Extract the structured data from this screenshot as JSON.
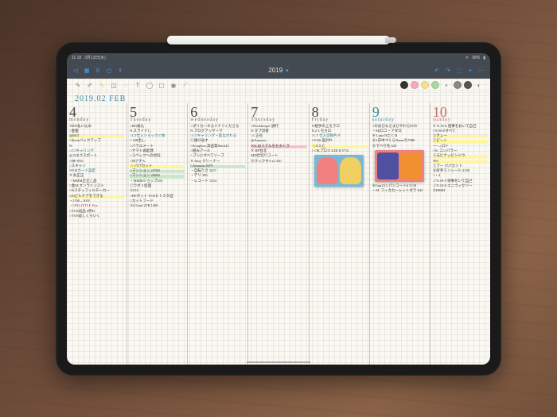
{
  "status": {
    "time": "11:18",
    "date": "3月13日(水)",
    "battery": "98%"
  },
  "app": {
    "back": "◁",
    "title": "2019",
    "dropdown": "▾"
  },
  "toolbar_colors": {
    "black": "#333333",
    "pink": "#f8a8c0",
    "yellow": "#f8e088",
    "green": "#a8d8a0",
    "gray": "#888888",
    "darkgray": "#555555"
  },
  "planner": {
    "month_header": "2019.02 FEB",
    "days": [
      {
        "num": "4",
        "name": "monday",
        "class": "",
        "entries": [
          {
            "t": "✕RN払い込み",
            "c": ""
          },
          {
            "t": "○金髪",
            "c": ""
          },
          {
            "t": "◎M15",
            "c": "hl-yellow"
          },
          {
            "t": "○Slackバックアップ",
            "c": ""
          },
          {
            "t": "N.",
            "c": ""
          },
          {
            "t": "○CTキャリング",
            "c": "blue-ink"
          },
          {
            "t": "◎ Nエクスポート",
            "c": ""
          },
          {
            "t": "○HP SNS",
            "c": ""
          },
          {
            "t": "○スキャン",
            "c": ""
          },
          {
            "t": "NNMカード設定",
            "c": "blue-ink"
          },
          {
            "t": "✕ お正正",
            "c": ""
          },
          {
            "t": "・MMM正正こ品",
            "c": ""
          },
          {
            "t": "○金M オンラインスト",
            "c": ""
          },
          {
            "t": "○Nスタッフィルターカー",
            "c": ""
          },
          {
            "t": "○Elビルケアをできる",
            "c": "hl-yellow"
          },
          {
            "t": "・11M→ASV",
            "c": ""
          },
          {
            "t": "・OH LITTLE Fire",
            "c": "red-ink"
          },
          {
            "t": "○YOS返品 4件D",
            "c": ""
          },
          {
            "t": "○YOS返しくらいく",
            "c": ""
          }
        ]
      },
      {
        "num": "5",
        "name": "Tuesday",
        "class": "",
        "entries": [
          {
            "t": "○RN振込",
            "c": ""
          },
          {
            "t": "N.スライドし",
            "c": ""
          },
          {
            "t": "○CT仕入ショック27本",
            "c": "blue-ink"
          },
          {
            "t": "○ GB出し",
            "c": ""
          },
          {
            "t": "○バラエメート",
            "c": ""
          },
          {
            "t": "○ヤマト再配達",
            "c": ""
          },
          {
            "t": "○スペックへの合同",
            "c": ""
          },
          {
            "t": "○MナチA",
            "c": ""
          },
          {
            "t": "⭐パパカット",
            "c": "hl-yellow"
          },
          {
            "t": "○マンション    23700",
            "c": "hl-green"
          },
          {
            "t": "○マンション    28500",
            "c": "hl-green"
          },
          {
            "t": "・MMMショップ255",
            "c": ""
          },
          {
            "t": "◎ラボ 5 処理",
            "c": ""
          },
          {
            "t": "  ①210",
            "c": ""
          },
          {
            "t": "○DFボット YOSヒトスタ証",
            "c": ""
          },
          {
            "t": "○カットフード",
            "c": ""
          },
          {
            "t": "①iCloud 2TB    1400",
            "c": ""
          }
        ]
      },
      {
        "num": "6",
        "name": "wednesday",
        "class": "",
        "entries": [
          {
            "t": "○ポリカーネカミナリくださる",
            "c": ""
          },
          {
            "t": "N.ブログアッサーマ",
            "c": ""
          },
          {
            "t": "○CTキャリング・館なかれる",
            "c": "blue-ink"
          },
          {
            "t": "◎請け返す",
            "c": ""
          },
          {
            "t": "○Scrapbox 高品質Slackに",
            "c": ""
          },
          {
            "t": "○組みアール",
            "c": ""
          },
          {
            "t": "○プシにすべてソープ",
            "c": ""
          },
          {
            "t": "✕ Amy クリーナー",
            "c": ""
          },
          {
            "t": "○Amazon     2979",
            "c": "hl-green"
          },
          {
            "t": "  ・自転りさ 3437",
            "c": ""
          },
          {
            "t": "  ・デリ     300",
            "c": ""
          },
          {
            "t": "  ・レコート 1354",
            "c": ""
          }
        ]
      },
      {
        "num": "7",
        "name": "Thursday",
        "class": "",
        "entries": [
          {
            "t": "○Duckkeeper 調行",
            "c": ""
          },
          {
            "t": "N.タブ切替",
            "c": ""
          },
          {
            "t": "○C正長",
            "c": "blue-ink"
          },
          {
            "t": "◎Amazon",
            "c": ""
          },
          {
            "t": "✕N.おリアルをセネトラ",
            "c": "hl-pink"
          },
          {
            "t": "✕ HP台北",
            "c": ""
          },
          {
            "t": "MD仕切りコート",
            "c": ""
          },
          {
            "t": "⑥クックキ3 x2  320",
            "c": ""
          }
        ]
      },
      {
        "num": "8",
        "name": "Friday",
        "class": "",
        "entries": [
          {
            "t": "✕相手の上モラロ",
            "c": ""
          },
          {
            "t": "N.2 3 モカロ",
            "c": ""
          },
          {
            "t": "○CT 仕入切替片④",
            "c": "blue-ink"
          },
          {
            "t": "○YOS 設計れ",
            "c": ""
          },
          {
            "t": "⭐Eミと",
            "c": "hl-yellow"
          },
          {
            "t": "○ OKプロジェIB D  5731",
            "c": ""
          }
        ],
        "photo": 1
      },
      {
        "num": "9",
        "name": "saturday",
        "class": "saturday",
        "entries": [
          {
            "t": "○のおひなさまひやわらわわ",
            "c": ""
          },
          {
            "t": "・MIロコ・アダロ",
            "c": ""
          },
          {
            "t": "⑥ Luna Nた C B",
            "c": ""
          },
          {
            "t": "⑥1日中づくらNameち7980",
            "c": ""
          },
          {
            "t": "⑥でべり先  420",
            "c": ""
          }
        ],
        "photo": 2,
        "after": [
          {
            "t": "⑥Gap10.5 パシコート6  5138",
            "c": ""
          },
          {
            "t": "・M. フィカカーレットガラ  943",
            "c": ""
          }
        ]
      },
      {
        "num": "10",
        "name": "sunday",
        "class": "sunday",
        "entries": [
          {
            "t": "✕ N.18-S 侵事をおいて自己",
            "c": ""
          },
          {
            "t": "○YOS③すべて",
            "c": ""
          },
          {
            "t": "①きょー",
            "c": "hl-yellow"
          },
          {
            "t": "①ビーン",
            "c": "hl-yellow"
          },
          {
            "t": "  ──→ロト",
            "c": ""
          },
          {
            "t": "○N. コンパラー",
            "c": ""
          },
          {
            "t": "①モビナッピンドウ",
            "c": "hl-yellow"
          },
          {
            "t": "  595",
            "c": "hl-yellow"
          },
          {
            "t": "①ブー  パパカント",
            "c": ""
          },
          {
            "t": "⑥好手ミンッール 2100",
            "c": ""
          },
          {
            "t": "  ×・4",
            "c": ""
          },
          {
            "t": "",
            "c": ""
          },
          {
            "t": "ノN.18-5 侵事をいて自己",
            "c": ""
          },
          {
            "t": "ノN.18-6 エニウィかゾー",
            "c": ""
          },
          {
            "t": "①DMM",
            "c": ""
          }
        ]
      }
    ]
  }
}
